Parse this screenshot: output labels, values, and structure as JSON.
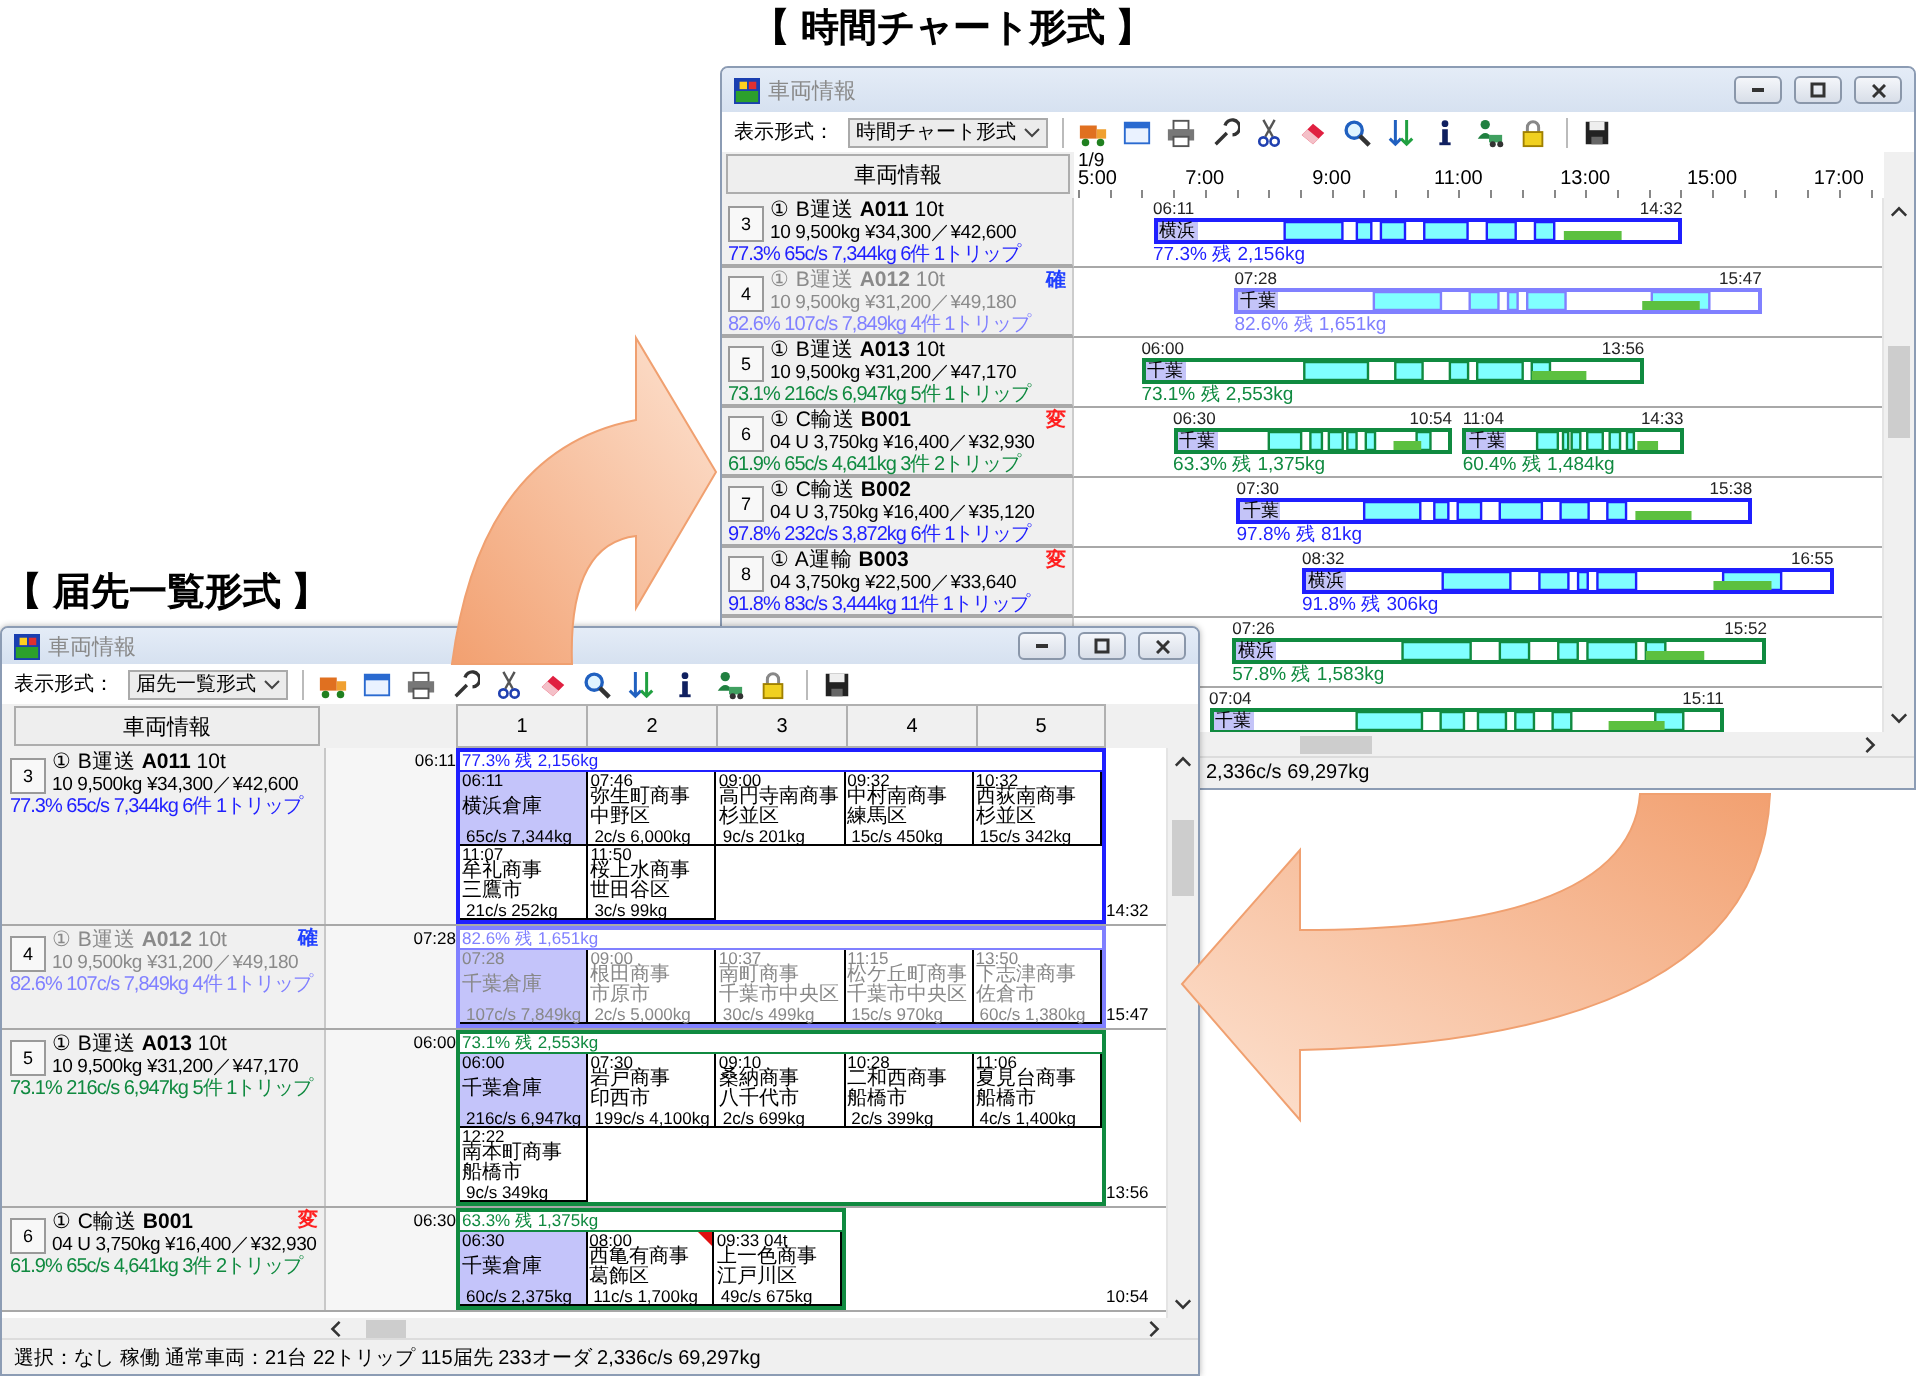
{
  "views": [
    {
      "kind": "time_chart",
      "caption": "【 時間チャート形式 】",
      "window": {
        "title": "車両情報",
        "display_label": "表示形式：",
        "display_value": "時間チャート形式",
        "header_button": "車両情報",
        "date": "1/9",
        "hours": [
          "5:00",
          "7:00",
          "9:00",
          "11:00",
          "13:00",
          "15:00",
          "17:00"
        ],
        "status": "2,336c/s 69,297kg",
        "rows": [
          {
            "number": "3",
            "title": "① B運送 **A011** 10t",
            "spec": "10 9,500kg ¥34,300／¥42,600",
            "stats": "77.3%  65c/s 7,344kg  6件  1トリップ",
            "dimmed": false,
            "color": "#1f1fff",
            "bars": [
              {
                "start": "06:11",
                "end": "14:32",
                "depot": "横浜",
                "summary": "77.3% 残 2,156kg"
              }
            ]
          },
          {
            "number": "4",
            "title": "① B運送 **A012** 10t",
            "spec": "10 9,500kg ¥31,200／¥49,180",
            "stats": "82.6%  107c/s 7,849kg  4件  1トリップ",
            "dimmed": true,
            "color": "#8080ff",
            "badge": {
              "text": "確",
              "color": "#2040ff"
            },
            "bars": [
              {
                "start": "07:28",
                "end": "15:47",
                "depot": "千葉",
                "summary": "82.6% 残 1,651kg"
              }
            ]
          },
          {
            "number": "5",
            "title": "① B運送 **A013** 10t",
            "spec": "10 9,500kg ¥31,200／¥47,170",
            "stats": "73.1%  216c/s 6,947kg  5件  1トリップ",
            "dimmed": false,
            "color": "#108a40",
            "bars": [
              {
                "start": "06:00",
                "end": "13:56",
                "depot": "千葉",
                "summary": "73.1% 残 2,553kg"
              }
            ]
          },
          {
            "number": "6",
            "title": "① C輸送 **B001**",
            "spec": "04 U 3,750kg ¥16,400／¥32,930",
            "stats": "61.9%  65c/s 4,641kg  3件  2トリップ",
            "dimmed": false,
            "color": "#108a40",
            "badge": {
              "text": "変",
              "color": "#ff2020"
            },
            "bars": [
              {
                "start": "06:30",
                "end": "10:54",
                "depot": "千葉",
                "summary": "63.3% 残 1,375kg"
              },
              {
                "start": "11:04",
                "end": "14:33",
                "depot": "千葉",
                "summary": "60.4% 残 1,484kg"
              }
            ]
          },
          {
            "number": "7",
            "title": "① C輸送 **B002**",
            "spec": "04 U 3,750kg ¥16,400／¥35,120",
            "stats": "97.8%  232c/s 3,872kg  6件  1トリップ",
            "dimmed": false,
            "color": "#1f1fff",
            "bars": [
              {
                "start": "07:30",
                "end": "15:38",
                "depot": "千葉",
                "summary": "97.8% 残 81kg"
              }
            ]
          },
          {
            "number": "8",
            "title": "① A運輸 **B003**",
            "spec": "04 3,750kg ¥22,500／¥33,640",
            "stats": "91.8%  83c/s 3,444kg  11件  1トリップ",
            "dimmed": false,
            "color": "#1f1fff",
            "badge": {
              "text": "変",
              "color": "#ff2020"
            },
            "bars": [
              {
                "start": "08:32",
                "end": "16:55",
                "depot": "横浜",
                "summary": "91.8% 残 306kg"
              }
            ]
          },
          {
            "color": "#108a40",
            "bars": [
              {
                "start": "07:26",
                "end": "15:52",
                "depot": "横浜",
                "summary": "57.8% 残 1,583kg"
              }
            ]
          },
          {
            "color": "#108a40",
            "bars": [
              {
                "start": "07:04",
                "end": "15:11",
                "depot": "千葉"
              }
            ]
          }
        ]
      }
    },
    {
      "kind": "destination_list",
      "caption": "【 届先一覧形式 】",
      "window": {
        "title": "車両情報",
        "display_label": "表示形式：",
        "display_value": "届先一覧形式",
        "header_button": "車両情報",
        "columns": [
          "1",
          "2",
          "3",
          "4",
          "5"
        ],
        "status": "選択：なし 稼働 通常車両：21台 22トリップ 115届先 233オーダ 2,336c/s 69,297kg",
        "rows": [
          {
            "number": "3",
            "title": "① B運送 **A011** 10t",
            "spec": "10 9,500kg ¥34,300／¥42,600",
            "stats": "77.3%  65c/s 7,344kg  6件  1トリップ",
            "dimmed": false,
            "color": "#1f1fff",
            "start": "06:11",
            "end": "14:32",
            "summary": "77.3% 残 2,156kg",
            "cells": [
              {
                "time": "06:11",
                "name": "横浜倉庫",
                "load": "65c/s 7,344kg",
                "depot": true,
                "flagged": false
              },
              {
                "time": "07:46",
                "name": "弥生町商事",
                "area": "中野区",
                "load": "2c/s 6,000kg",
                "depot": false,
                "flagged": false
              },
              {
                "time": "09:00",
                "name": "高円寺南商事",
                "area": "杉並区",
                "load": "9c/s 201kg",
                "depot": false,
                "flagged": false
              },
              {
                "time": "09:32",
                "name": "中村南商事",
                "area": "練馬区",
                "load": "15c/s 450kg",
                "depot": false,
                "flagged": false
              },
              {
                "time": "10:32",
                "name": "西荻南商事",
                "area": "杉並区",
                "load": "15c/s 342kg",
                "depot": false,
                "flagged": false
              },
              {
                "time": "11:07",
                "name": "牟礼商事",
                "area": "三鷹市",
                "load": "21c/s 252kg",
                "depot": false,
                "flagged": false
              },
              {
                "time": "11:50",
                "name": "桜上水商事",
                "area": "世田谷区",
                "load": "3c/s 99kg",
                "depot": false,
                "flagged": false
              }
            ]
          },
          {
            "number": "4",
            "title": "① B運送 **A012** 10t",
            "spec": "10 9,500kg ¥31,200／¥49,180",
            "stats": "82.6%  107c/s 7,849kg  4件  1トリップ",
            "dimmed": true,
            "color": "#8080ff",
            "badge": {
              "text": "確",
              "color": "#2040ff"
            },
            "start": "07:28",
            "end": "15:47",
            "summary": "82.6% 残 1,651kg",
            "cells": [
              {
                "time": "07:28",
                "name": "千葉倉庫",
                "load": "107c/s 7,849kg",
                "depot": true,
                "flagged": false
              },
              {
                "time": "09:00",
                "name": "根田商事",
                "area": "市原市",
                "load": "2c/s 5,000kg",
                "depot": false,
                "flagged": false
              },
              {
                "time": "10:37",
                "name": "南町商事",
                "area": "千葉市中央区",
                "load": "30c/s 499kg",
                "depot": false,
                "flagged": false
              },
              {
                "time": "11:15",
                "name": "松ケ丘町商事",
                "area": "千葉市中央区",
                "load": "15c/s 970kg",
                "depot": false,
                "flagged": false
              },
              {
                "time": "13:50",
                "name": "下志津商事",
                "area": "佐倉市",
                "load": "60c/s 1,380kg",
                "depot": false,
                "flagged": false
              }
            ]
          },
          {
            "number": "5",
            "title": "① B運送 **A013** 10t",
            "spec": "10 9,500kg ¥31,200／¥47,170",
            "stats": "73.1%  216c/s 6,947kg  5件  1トリップ",
            "dimmed": false,
            "color": "#108a40",
            "start": "06:00",
            "end": "13:56",
            "summary": "73.1% 残 2,553kg",
            "cells": [
              {
                "time": "06:00",
                "name": "千葉倉庫",
                "load": "216c/s 6,947kg",
                "depot": true,
                "flagged": false
              },
              {
                "time": "07:30",
                "name": "岩戸商事",
                "area": "印西市",
                "load": "199c/s 4,100kg",
                "depot": false,
                "flagged": false
              },
              {
                "time": "09:10",
                "name": "桑納商事",
                "area": "八千代市",
                "load": "2c/s 699kg",
                "depot": false,
                "flagged": false
              },
              {
                "time": "10:28",
                "name": "二和西商事",
                "area": "船橋市",
                "load": "2c/s 399kg",
                "depot": false,
                "flagged": false
              },
              {
                "time": "11:06",
                "name": "夏見台商事",
                "area": "船橋市",
                "load": "4c/s 1,400kg",
                "depot": false,
                "flagged": false
              },
              {
                "time": "12:22",
                "name": "南本町商事",
                "area": "船橋市",
                "load": "9c/s 349kg",
                "depot": false,
                "flagged": false
              }
            ]
          },
          {
            "number": "6",
            "title": "① C輸送 **B001**",
            "spec": "04 U 3,750kg ¥16,400／¥32,930",
            "stats": "61.9%  65c/s 4,641kg  3件  2トリップ",
            "dimmed": false,
            "color": "#108a40",
            "badge": {
              "text": "変",
              "color": "#ff2020"
            },
            "start": "06:30",
            "end": "10:54",
            "summary": "63.3% 残 1,375kg",
            "cells": [
              {
                "time": "06:30",
                "name": "千葉倉庫",
                "load": "60c/s 2,375kg",
                "depot": true,
                "flagged": false
              },
              {
                "time": "08:00",
                "name": "西亀有商事",
                "area": "葛飾区",
                "load": "11c/s 1,700kg",
                "depot": false,
                "flagged": true
              },
              {
                "time": "09:33  04t",
                "name": "上一色商事",
                "area": "江戸川区",
                "load": "49c/s 675kg",
                "depot": false,
                "flagged": false
              }
            ]
          }
        ]
      }
    }
  ]
}
